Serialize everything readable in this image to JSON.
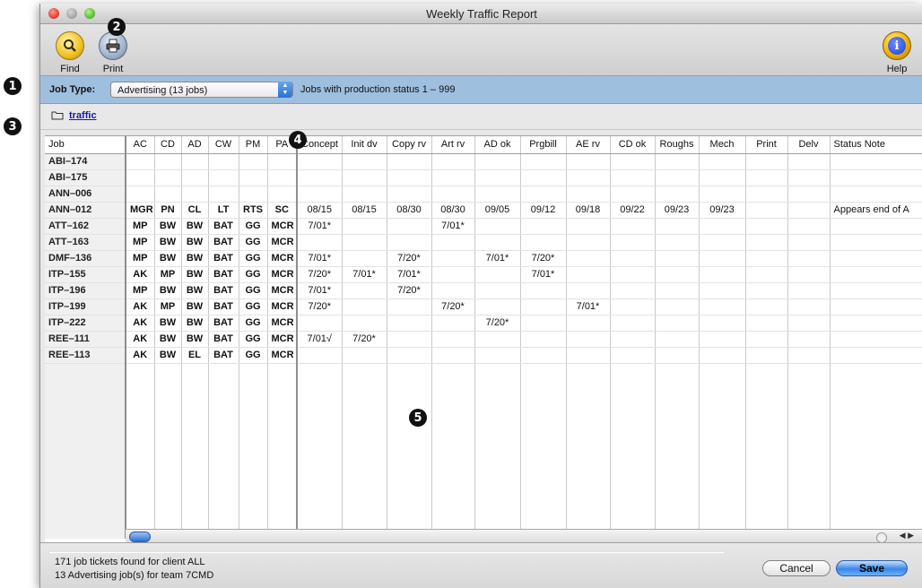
{
  "callouts": [
    "1",
    "2",
    "3",
    "4",
    "5"
  ],
  "window": {
    "title": "Weekly Traffic Report"
  },
  "toolbar": {
    "find_label": "Find",
    "print_label": "Print",
    "help_label": "Help",
    "help_glyph": "i"
  },
  "jobbar": {
    "label": "Job Type:",
    "selected": "Advertising (13 jobs)",
    "status_text": "Jobs with production status 1 – 999"
  },
  "path": {
    "link": "traffic"
  },
  "table": {
    "columns": [
      "Job",
      "AC",
      "CD",
      "AD",
      "CW",
      "PM",
      "PA",
      "Concept",
      "Init dv",
      "Copy rv",
      "Art rv",
      "AD ok",
      "Prgbill",
      "AE rv",
      "CD ok",
      "Roughs",
      "Mech",
      "Print",
      "Delv",
      "Status Note"
    ],
    "rows": [
      [
        "ABI–174",
        "",
        "",
        "",
        "",
        "",
        "",
        "",
        "",
        "",
        "",
        "",
        "",
        "",
        "",
        "",
        "",
        "",
        "",
        ""
      ],
      [
        "ABI–175",
        "",
        "",
        "",
        "",
        "",
        "",
        "",
        "",
        "",
        "",
        "",
        "",
        "",
        "",
        "",
        "",
        "",
        "",
        ""
      ],
      [
        "ANN–006",
        "",
        "",
        "",
        "",
        "",
        "",
        "",
        "",
        "",
        "",
        "",
        "",
        "",
        "",
        "",
        "",
        "",
        "",
        ""
      ],
      [
        "ANN–012",
        "MGR",
        "PN",
        "CL",
        "LT",
        "RTS",
        "SC",
        "08/15",
        "08/15",
        "08/30",
        "08/30",
        "09/05",
        "09/12",
        "09/18",
        "09/22",
        "09/23",
        "09/23",
        "",
        "",
        "Appears end of A"
      ],
      [
        "ATT–162",
        "MP",
        "BW",
        "BW",
        "BAT",
        "GG",
        "MCR",
        "7/01*",
        "",
        "",
        "7/01*",
        "",
        "",
        "",
        "",
        "",
        "",
        "",
        "",
        ""
      ],
      [
        "ATT–163",
        "MP",
        "BW",
        "BW",
        "BAT",
        "GG",
        "MCR",
        "",
        "",
        "",
        "",
        "",
        "",
        "",
        "",
        "",
        "",
        "",
        "",
        ""
      ],
      [
        "DMF–136",
        "MP",
        "BW",
        "BW",
        "BAT",
        "GG",
        "MCR",
        "7/01*",
        "",
        "7/20*",
        "",
        "7/01*",
        "7/20*",
        "",
        "",
        "",
        "",
        "",
        "",
        ""
      ],
      [
        "ITP–155",
        "AK",
        "MP",
        "BW",
        "BAT",
        "GG",
        "MCR",
        "7/20*",
        "7/01*",
        "7/01*",
        "",
        "",
        "7/01*",
        "",
        "",
        "",
        "",
        "",
        "",
        ""
      ],
      [
        "ITP–196",
        "MP",
        "BW",
        "BW",
        "BAT",
        "GG",
        "MCR",
        "7/01*",
        "",
        "7/20*",
        "",
        "",
        "",
        "",
        "",
        "",
        "",
        "",
        "",
        ""
      ],
      [
        "ITP–199",
        "AK",
        "MP",
        "BW",
        "BAT",
        "GG",
        "MCR",
        "7/20*",
        "",
        "",
        "7/20*",
        "",
        "",
        "7/01*",
        "",
        "",
        "",
        "",
        "",
        ""
      ],
      [
        "ITP–222",
        "AK",
        "BW",
        "BW",
        "BAT",
        "GG",
        "MCR",
        "",
        "",
        "",
        "",
        "7/20*",
        "",
        "",
        "",
        "",
        "",
        "",
        "",
        ""
      ],
      [
        "REE–111",
        "AK",
        "BW",
        "BW",
        "BAT",
        "GG",
        "MCR",
        "7/01√",
        "7/20*",
        "",
        "",
        "",
        "",
        "",
        "",
        "",
        "",
        "",
        "",
        ""
      ],
      [
        "REE–113",
        "AK",
        "BW",
        "EL",
        "BAT",
        "GG",
        "MCR",
        "",
        "",
        "",
        "",
        "",
        "",
        "",
        "",
        "",
        "",
        "",
        "",
        ""
      ]
    ]
  },
  "status": {
    "line1": "171 job tickets found for client ALL",
    "line2": "13 Advertising job(s) for team 7CMD"
  },
  "buttons": {
    "cancel": "Cancel",
    "save": "Save"
  }
}
